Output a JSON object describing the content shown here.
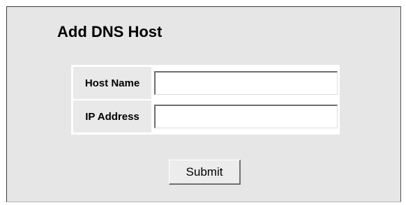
{
  "page": {
    "title": "Add DNS Host"
  },
  "form": {
    "host_name": {
      "label": "Host Name",
      "value": "",
      "placeholder": ""
    },
    "ip_address": {
      "label": "IP Address",
      "value": "",
      "placeholder": ""
    },
    "submit_label": "Submit"
  },
  "colors": {
    "panel_background": "#e6e6e6",
    "label_background": "#e9e9e9",
    "table_background": "#ffffff"
  }
}
